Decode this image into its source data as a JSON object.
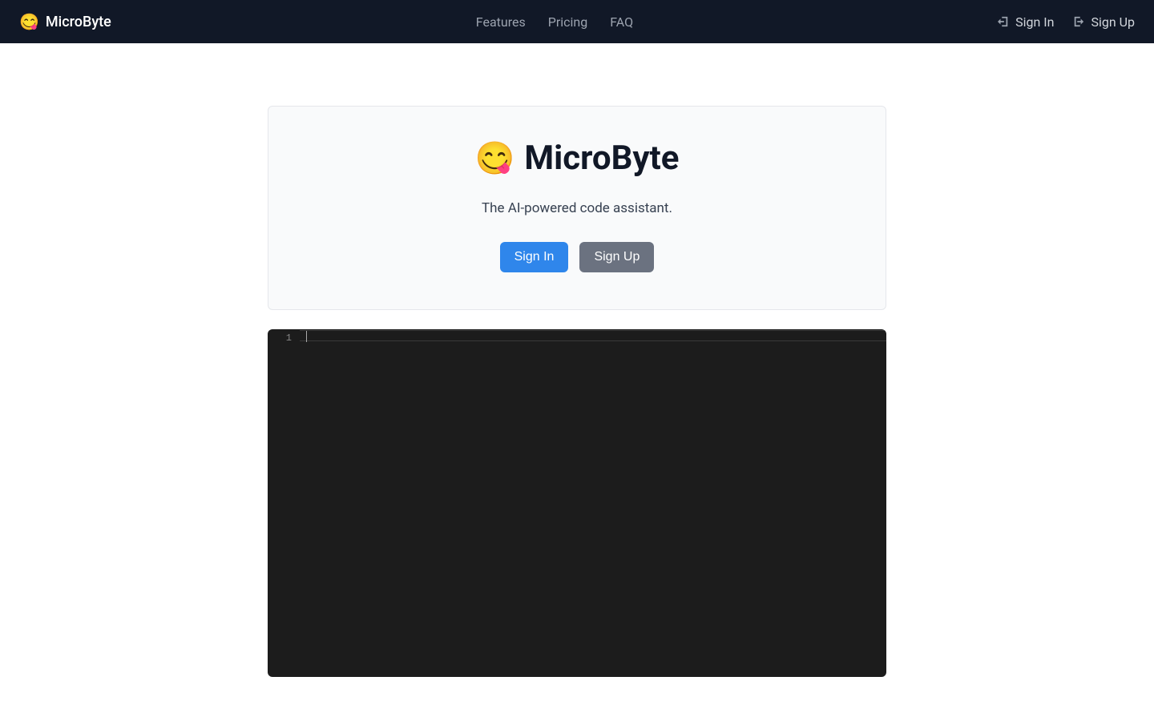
{
  "navbar": {
    "brand_emoji": "😋",
    "brand_text": "MicroByte",
    "links": {
      "features": "Features",
      "pricing": "Pricing",
      "faq": "FAQ"
    },
    "auth": {
      "sign_in": "Sign In",
      "sign_up": "Sign Up"
    }
  },
  "hero": {
    "emoji": "😋",
    "title": "MicroByte",
    "subtitle": "The AI-powered code assistant.",
    "sign_in_button": "Sign In",
    "sign_up_button": "Sign Up"
  },
  "editor": {
    "line_numbers": [
      "1"
    ],
    "content": ""
  }
}
